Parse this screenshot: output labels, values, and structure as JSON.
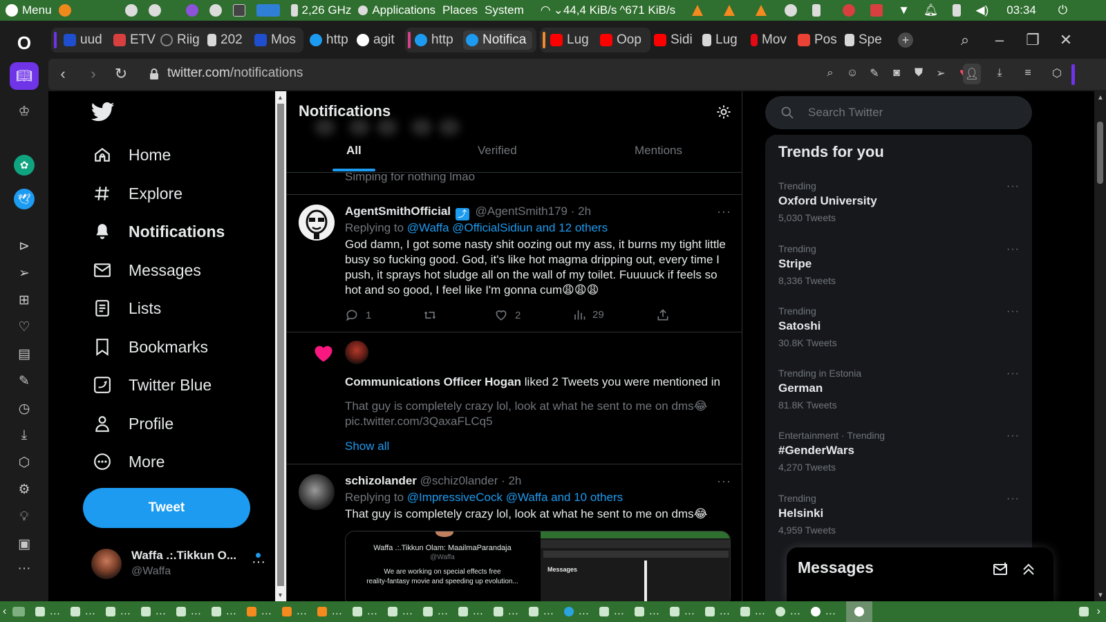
{
  "os_panel": {
    "menu_label": "Menu",
    "cpu_freq": "2,26 GHz",
    "applications_label": "Applications",
    "places_label": "Places",
    "system_label": "System",
    "net_down": "44,4 KiB/s",
    "net_up": "671 KiB/s",
    "clock": "03:34"
  },
  "tabs": [
    {
      "label": "uud",
      "icon": "tab-favicon",
      "color": "#1f4fcf"
    },
    {
      "label": "ETV",
      "icon": "tab-favicon",
      "color": "#d84040"
    },
    {
      "label": "Riig",
      "icon": "tab-favicon",
      "color": "#555555"
    },
    {
      "label": "202",
      "icon": "document-icon",
      "color": "#d8d8d8"
    },
    {
      "label": "Mos",
      "icon": "tab-favicon",
      "color": "#1f4fcf"
    },
    {
      "label": "http",
      "icon": "twitter-icon",
      "color": "#1d9bf0"
    },
    {
      "label": "agit",
      "icon": "google-icon",
      "color": "#ffffff"
    },
    {
      "label": "http",
      "icon": "twitter-icon",
      "color": "#1d9bf0"
    },
    {
      "label": "Notifica",
      "icon": "twitter-icon",
      "color": "#1d9bf0"
    },
    {
      "label": "Lug",
      "icon": "youtube-icon",
      "color": "#ff0000"
    },
    {
      "label": "Oop",
      "icon": "youtube-icon",
      "color": "#ff0000"
    },
    {
      "label": "Sidi",
      "icon": "youtube-icon",
      "color": "#ff0000"
    },
    {
      "label": "Lug",
      "icon": "document-icon",
      "color": "#d8d8d8"
    },
    {
      "label": "Mov",
      "icon": "netflix-icon",
      "color": "#e50914"
    },
    {
      "label": "Pos",
      "icon": "gmail-icon",
      "color": "#ea4335"
    },
    {
      "label": "Spe",
      "icon": "grid-icon",
      "color": "#d8d8d8"
    }
  ],
  "address": {
    "domain": "twitter.com",
    "path": "/notifications"
  },
  "nav": [
    {
      "label": "Home",
      "icon": "home-icon"
    },
    {
      "label": "Explore",
      "icon": "hashtag-icon"
    },
    {
      "label": "Notifications",
      "icon": "bell-icon"
    },
    {
      "label": "Messages",
      "icon": "envelope-icon"
    },
    {
      "label": "Lists",
      "icon": "list-icon"
    },
    {
      "label": "Bookmarks",
      "icon": "bookmark-icon"
    },
    {
      "label": "Twitter Blue",
      "icon": "twitter-blue-icon"
    },
    {
      "label": "Profile",
      "icon": "person-icon"
    },
    {
      "label": "More",
      "icon": "more-circle-icon"
    }
  ],
  "tweet_button": "Tweet",
  "account": {
    "name": "Waffa .:.Tikkun O...",
    "handle": "@Waffa"
  },
  "timeline": {
    "title": "Notifications",
    "tabs": [
      "All",
      "Verified",
      "Mentions"
    ],
    "partial_top_line": "Simping for nothing lmao",
    "post1": {
      "name": "AgentSmithOfficial",
      "handle": "@AgentSmith179",
      "time": "· 2h",
      "replying_prefix": "Replying to",
      "replying_mentions": "@Waffa @OfficialSidiun and 12 others",
      "lines": [
        "God damn, I got some nasty shit oozing out my ass, it burns my tight little",
        "busy so fucking good. God, it's like hot magma dripping out, every time I",
        "push, it sprays hot sludge all on the wall of my toilet. Fuuuuck if feels so",
        "hot and so good, I feel like I'm gonna cum😩😩😩"
      ],
      "replies": "1",
      "likes": "2",
      "views": "29"
    },
    "like_notification": {
      "actor": "Communications Officer Hogan",
      "action": "liked 2 Tweets you were mentioned in",
      "preview_line1": "That guy is completely crazy lol, look at what he sent to me on dms😂",
      "preview_line2": "pic.twitter.com/3QaxaFLCq5",
      "show_all": "Show all"
    },
    "post2": {
      "name": "schizolander",
      "handle": "@schiz0lander",
      "time": "· 2h",
      "replying_prefix": "Replying to",
      "replying_mentions": "@ImpressiveCock @Waffa and 10 others",
      "text": "That guy is completely crazy lol, look at what he sent to me on dms😂",
      "embed_left_title": "Waffa .:.Tikkun Olam: MaailmaParandaja",
      "embed_left_handle": "@Waffa",
      "embed_left_body1": "We are working on special effects free",
      "embed_left_body2": "reality-fantasy movie and speeding up evolution...",
      "embed_right_caption": "Messages"
    }
  },
  "search": {
    "placeholder": "Search Twitter"
  },
  "trends": {
    "title": "Trends for you",
    "items": [
      {
        "context": "Trending",
        "name": "Oxford University",
        "count": "5,030 Tweets"
      },
      {
        "context": "Trending",
        "name": "Stripe",
        "count": "8,336 Tweets"
      },
      {
        "context": "Trending",
        "name": "Satoshi",
        "count": "30.8K Tweets"
      },
      {
        "context": "Trending in Estonia",
        "name": "German",
        "count": "81.8K Tweets"
      },
      {
        "context": "Entertainment · Trending",
        "name": "#GenderWars",
        "count": "4,270 Tweets"
      },
      {
        "context": "Trending",
        "name": "Helsinki",
        "count": "4,959 Tweets"
      }
    ]
  },
  "messages_drawer": {
    "title": "Messages"
  },
  "colors": {
    "accent": "#1d9bf0",
    "os_panel": "#2f6f2f",
    "browser_accent": "#6f33e8",
    "like_heart": "#f91880"
  }
}
